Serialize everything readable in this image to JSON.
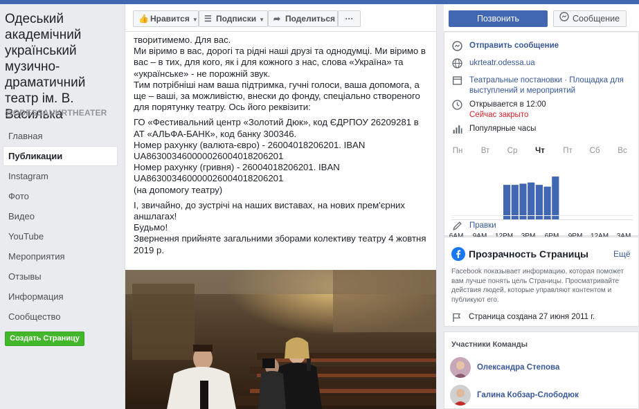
{
  "page": {
    "name": "Одеський академічний український музично-драматичний театр ім. В. Василька",
    "handle": "@ODESSAUKRTHEATER"
  },
  "nav": {
    "items": [
      "Главная",
      "Публикации",
      "Instagram",
      "Фото",
      "Видео",
      "YouTube",
      "Мероприятия",
      "Отзывы",
      "Информация",
      "Сообщество"
    ],
    "active_index": 1,
    "create_page_label": "Создать Страницу"
  },
  "actions": {
    "like_label": "Нравится",
    "follow_label": "Подписки",
    "share_label": "Поделиться",
    "more_label": "···"
  },
  "post": {
    "lines": [
      "творитимемо. Для вас.",
      "Ми віримо в вас, дорогі та рідні наші друзі та однодумці. Ми віримо в вас – в тих, для кого, як і для кожного з нас, слова «Україна» та «українське» - не порожній звук.",
      "Тим потрібніші нам ваша підтримка, гучні голоси, ваша допомога, а ще – ваші, за можливістю, внески до фонду, спеціально створеного для порятунку театру. Ось його реквізити:"
    ],
    "requisites": [
      "ГО «Фестивальний центр «Золотий Дюк», код ЄДРПОУ 26209281 в АТ «АЛЬФА-БАНК», код банку 300346.",
      "Номер рахунку (валюта-євро) - 26004018206201. IBAN UA863003460000026004018206201",
      "Номер рахунку (гривня) - 26004018206201. IBAN UA863003460000026004018206201",
      "(на допомогу театру)"
    ],
    "closing": [
      "І, звичайно, до зустрічі на наших виставах, на нових прем'єрних аншлагах!",
      "Будьмо!",
      "Звернення прийняте загальними зборами колективу театру 4 жовтня 2019 р."
    ]
  },
  "sidebar": {
    "call_label": "Позвонить",
    "message_label": "Сообщение",
    "send_message": "Отправить сообщение",
    "website": "ukrteatr.odessa.ua",
    "categories": "Театральные постановки · Площадка для выступлений и мероприятий",
    "opens": "Открывается в 12:00",
    "closed_now": "Сейчас закрыто",
    "popular_hours": "Популярные часы",
    "days": [
      "Пн",
      "Вт",
      "Ср",
      "Чт",
      "Пт",
      "Сб",
      "Вс"
    ],
    "today_index": 3,
    "times": [
      "6AM",
      "9AM",
      "12PM",
      "3PM",
      "6PM",
      "9PM",
      "12AM",
      "3AM"
    ],
    "edit_label": "Правки"
  },
  "chart_data": {
    "type": "bar",
    "title": "",
    "categories": [
      "12PM",
      "1PM",
      "2PM",
      "3PM",
      "4PM",
      "5PM",
      "6PM"
    ],
    "values": [
      58,
      58,
      60,
      62,
      58,
      55,
      72
    ],
    "ylim": [
      0,
      100
    ],
    "color": "#4267b2"
  },
  "transparency": {
    "title": "Прозрачность Страницы",
    "more_label": "Ещё",
    "description": "Facebook показывает информацию, которая поможет вам лучше понять цель Страницы. Просматривайте действия людей, которые управляют контентом и публикуют его.",
    "created": "Страница создана 27 июня 2011 г."
  },
  "team": {
    "title": "Участники Команды",
    "members": [
      "Олександра Степова",
      "Галина Кобзар-Слободюк"
    ]
  },
  "colors": {
    "brand": "#4267b2",
    "link": "#385898",
    "green": "#42b72a",
    "closed": "#d8202a"
  }
}
